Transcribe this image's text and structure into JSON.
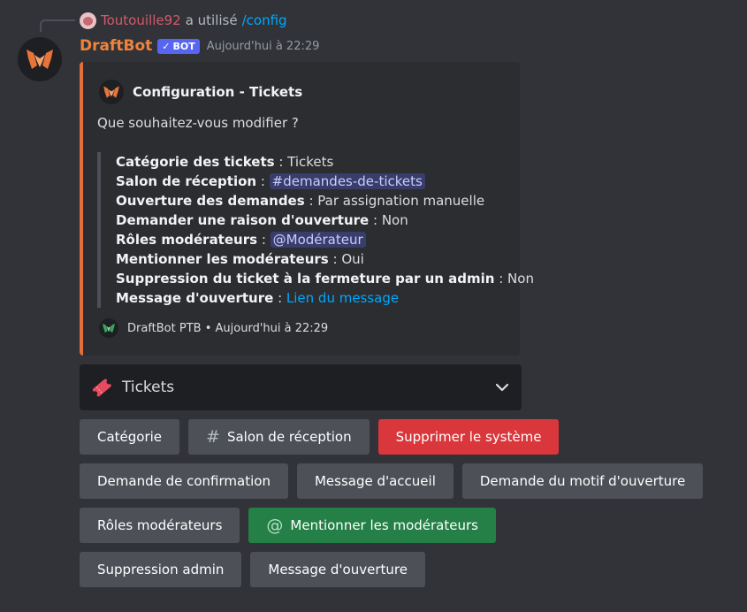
{
  "reply": {
    "username": "Toutouille92",
    "action": "a utilisé",
    "command": "/config"
  },
  "message": {
    "author": "DraftBot",
    "bot_tag": "BOT",
    "timestamp": "Aujourd'hui à 22:29"
  },
  "embed": {
    "accent_color": "#e1703a",
    "title": "Configuration - Tickets",
    "description": "Que souhaitez-vous modifier ?",
    "fields": [
      {
        "key": "Catégorie des tickets",
        "sep": " : ",
        "value": "Tickets"
      },
      {
        "key": "Salon de réception",
        "sep": " : ",
        "mention": "demandes-de-tickets"
      },
      {
        "key": "Ouverture des demandes",
        "sep": " : ",
        "value": "Par assignation manuelle"
      },
      {
        "key": "Demander une raison d'ouverture",
        "sep": " : ",
        "value": "Non"
      },
      {
        "key": "Rôles modérateurs",
        "sep": " : ",
        "mention": "@Modérateur"
      },
      {
        "key": "Mentionner les modérateurs",
        "sep": " : ",
        "value": "Oui"
      },
      {
        "key": "Suppression du ticket à la fermeture par un admin",
        "sep": " : ",
        "value": "Non"
      },
      {
        "key": "Message d'ouverture",
        "sep": " : ",
        "link": "Lien du message"
      }
    ],
    "footer": {
      "author": "DraftBot PTB",
      "dot": "•",
      "timestamp": "Aujourd'hui à 22:29"
    }
  },
  "select": {
    "value": "Tickets",
    "icon": "ticket-icon"
  },
  "buttons": {
    "categorie": "Catégorie",
    "salon": "Salon de réception",
    "supprimer": "Supprimer le système",
    "confirmation": "Demande de confirmation",
    "accueil": "Message d'accueil",
    "motif": "Demande du motif d'ouverture",
    "roles": "Rôles modérateurs",
    "mentionner": "Mentionner les modérateurs",
    "suppression_admin": "Suppression admin",
    "message_ouverture": "Message d'ouverture"
  },
  "colors": {
    "danger": "#da373c",
    "success": "#248046",
    "secondary": "#4e5058",
    "bot_name": "#f0833a"
  }
}
